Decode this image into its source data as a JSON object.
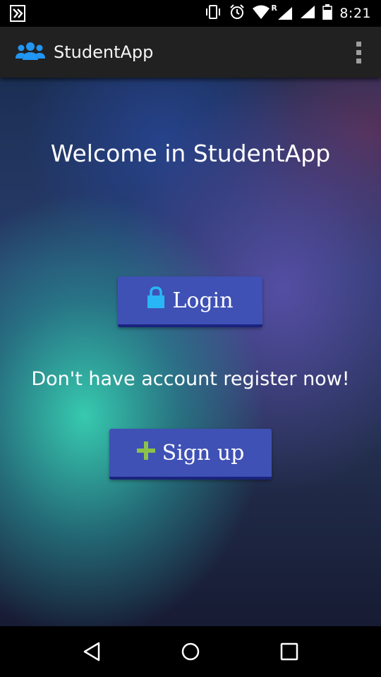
{
  "status_bar": {
    "time": "8:21",
    "icons": [
      "notification-icon",
      "vibrate-icon",
      "alarm-icon",
      "wifi-icon",
      "signal-roaming-icon",
      "cell-signal-icon",
      "battery-icon"
    ],
    "roaming_label": "R"
  },
  "app_bar": {
    "title": "StudentApp",
    "logo_icon": "students-group-icon",
    "menu_icon": "overflow-menu-icon"
  },
  "main": {
    "welcome": "Welcome in StudentApp",
    "login_button": {
      "label": "Login",
      "icon": "lock-icon",
      "icon_color": "#29b6f6"
    },
    "register_prompt": "Don't have account register now!",
    "signup_button": {
      "label": "Sign up",
      "icon": "plus-icon",
      "icon_color": "#8bc34a"
    }
  },
  "nav_bar": {
    "back": "back-icon",
    "home": "home-icon",
    "recents": "recents-icon"
  },
  "colors": {
    "button": "#3f51b5",
    "app_bar": "#212121",
    "accent_icon": "#2196f3"
  }
}
